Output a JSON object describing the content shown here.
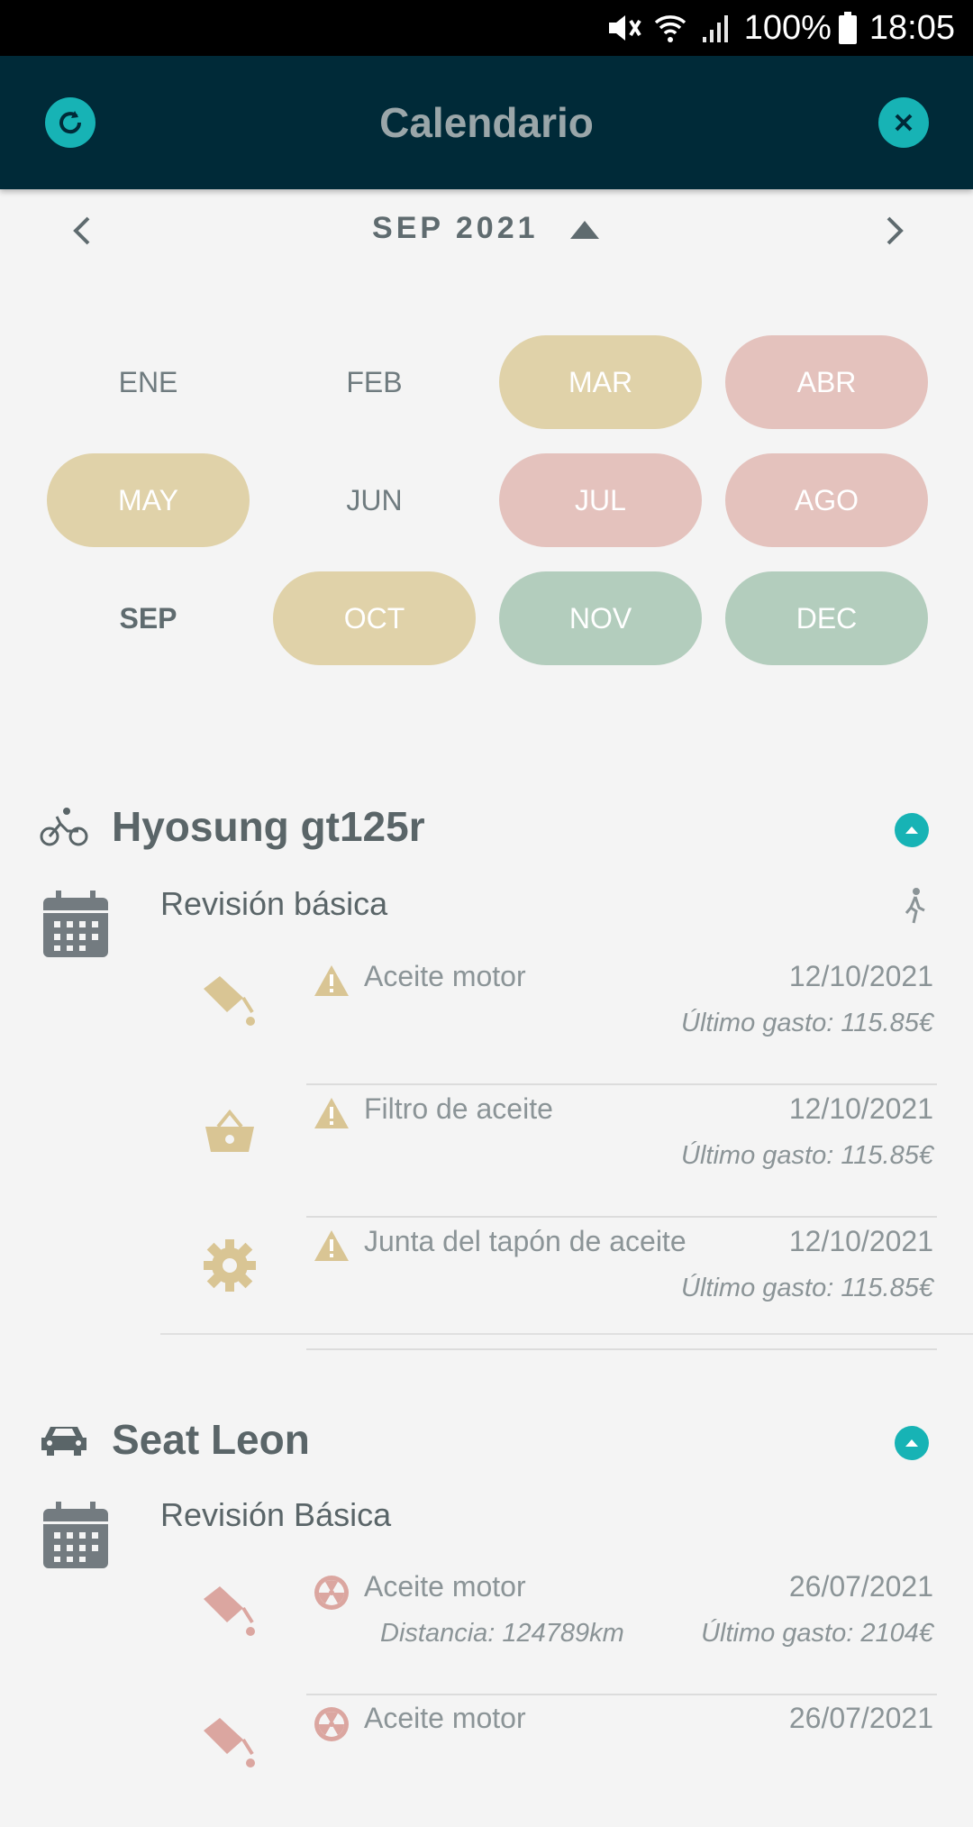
{
  "status_bar": {
    "battery": "100%",
    "time": "18:05"
  },
  "app_bar": {
    "title": "Calendario",
    "refresh_icon": "refresh-icon",
    "close_icon": "close-icon"
  },
  "month_nav": {
    "label": "SEP 2021"
  },
  "months": [
    {
      "label": "ENE",
      "state": "none"
    },
    {
      "label": "FEB",
      "state": "none"
    },
    {
      "label": "MAR",
      "state": "warning"
    },
    {
      "label": "ABR",
      "state": "alert"
    },
    {
      "label": "MAY",
      "state": "warning"
    },
    {
      "label": "JUN",
      "state": "none"
    },
    {
      "label": "JUL",
      "state": "alert"
    },
    {
      "label": "AGO",
      "state": "alert"
    },
    {
      "label": "SEP",
      "state": "current"
    },
    {
      "label": "OCT",
      "state": "warning"
    },
    {
      "label": "NOV",
      "state": "ok"
    },
    {
      "label": "DEC",
      "state": "ok"
    }
  ],
  "vehicles": [
    {
      "name": "Hyosung gt125r",
      "icon": "bicycle-icon",
      "service": {
        "title": "Revisión básica",
        "items": [
          {
            "icon": "oil-can-icon",
            "name": "Aceite motor",
            "date": "12/10/2021",
            "cost": "Último gasto: 115.85€"
          },
          {
            "icon": "basket-icon",
            "name": "Filtro de aceite",
            "date": "12/10/2021",
            "cost": "Último gasto: 115.85€"
          },
          {
            "icon": "gear-icon",
            "name": "Junta del tapón de aceite",
            "date": "12/10/2021",
            "cost": "Último gasto: 115.85€"
          }
        ]
      }
    },
    {
      "name": "Seat Leon",
      "icon": "car-icon",
      "service": {
        "title": "Revisión Básica",
        "items": [
          {
            "icon": "oil-can-icon",
            "name": "Aceite motor",
            "date": "26/07/2021",
            "distance": "Distancia: 124789km",
            "cost": "Último gasto: 2104€"
          },
          {
            "icon": "oil-can-icon",
            "name": "Aceite motor",
            "date": "26/07/2021"
          }
        ]
      }
    }
  ],
  "colors": {
    "accent": "#17b3b5",
    "appbar": "#002a38",
    "warning": "#e0d2a9",
    "alert": "#e4c2bd",
    "ok": "#b3cdbd"
  }
}
